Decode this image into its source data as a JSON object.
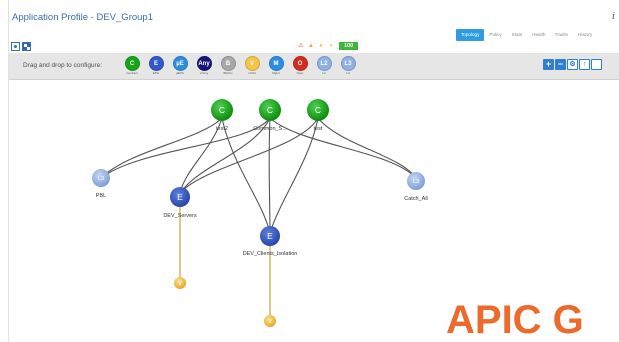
{
  "header": {
    "title": "Application Profile - DEV_Group1",
    "info_glyph": "i"
  },
  "tabs": [
    {
      "label": "Topology",
      "active": true
    },
    {
      "label": "Policy",
      "active": false
    },
    {
      "label": "Stats",
      "active": false
    },
    {
      "label": "Health",
      "active": false
    },
    {
      "label": "Faults",
      "active": false
    },
    {
      "label": "History",
      "active": false
    }
  ],
  "status": {
    "fault_icons": [
      {
        "glyph": "⚠",
        "color": "#e0453a"
      },
      {
        "glyph": "▲",
        "color": "#f39c3a"
      },
      {
        "glyph": "●",
        "color": "#f5c342"
      },
      {
        "glyph": "●",
        "color": "#f5d87a"
      }
    ],
    "health_score": "100",
    "health_color": "#3fb53c"
  },
  "palette": {
    "label": "Drag and drop to configure:",
    "items": [
      {
        "letter": "C",
        "label": "Contract",
        "color": "#16a516"
      },
      {
        "letter": "E",
        "label": "EPG",
        "color": "#3558c8"
      },
      {
        "letter": "µE",
        "label": "µEPG",
        "color": "#2d8ee0"
      },
      {
        "letter": "Any",
        "label": "vzAny",
        "color": "#15177a"
      },
      {
        "letter": "B",
        "label": "Bd/Ctx",
        "color": "#a8a8a8"
      },
      {
        "letter": "V",
        "label": "vzOut",
        "color": "#f5c54a"
      },
      {
        "letter": "M",
        "label": "Mgmt",
        "color": "#2d8ee0"
      },
      {
        "letter": "O",
        "label": "Oper",
        "color": "#d52b1e"
      },
      {
        "letter": "L2",
        "label": "L2",
        "color": "#8fb1e3"
      },
      {
        "letter": "L3",
        "label": "L3",
        "color": "#8fb1e3"
      }
    ]
  },
  "tools": {
    "add": "+",
    "remove": "−",
    "settings": "⚙",
    "upload": "↑"
  },
  "topology": {
    "contracts": [
      {
        "letter": "C",
        "label": "test2"
      },
      {
        "letter": "C",
        "label": "Common_S..."
      },
      {
        "letter": "C",
        "label": "test"
      }
    ],
    "epgs": [
      {
        "letter": "E",
        "label": "DEV_Servers"
      },
      {
        "letter": "E",
        "label": "DEV_Clients_Isolation"
      }
    ],
    "l3outs": [
      {
        "letter": "L3",
        "label": "PBL"
      },
      {
        "letter": "L3",
        "label": "Catch_All"
      }
    ],
    "vnodes": [
      {
        "letter": "V"
      },
      {
        "letter": "V"
      }
    ],
    "colors": {
      "contract": "#16a516",
      "epg": "#3558c8",
      "l3out": "#8fb1e3",
      "vnode": "#f5c54a",
      "link": "#555555",
      "vlink": "#c9a53d"
    }
  },
  "watermark": "APIC G"
}
